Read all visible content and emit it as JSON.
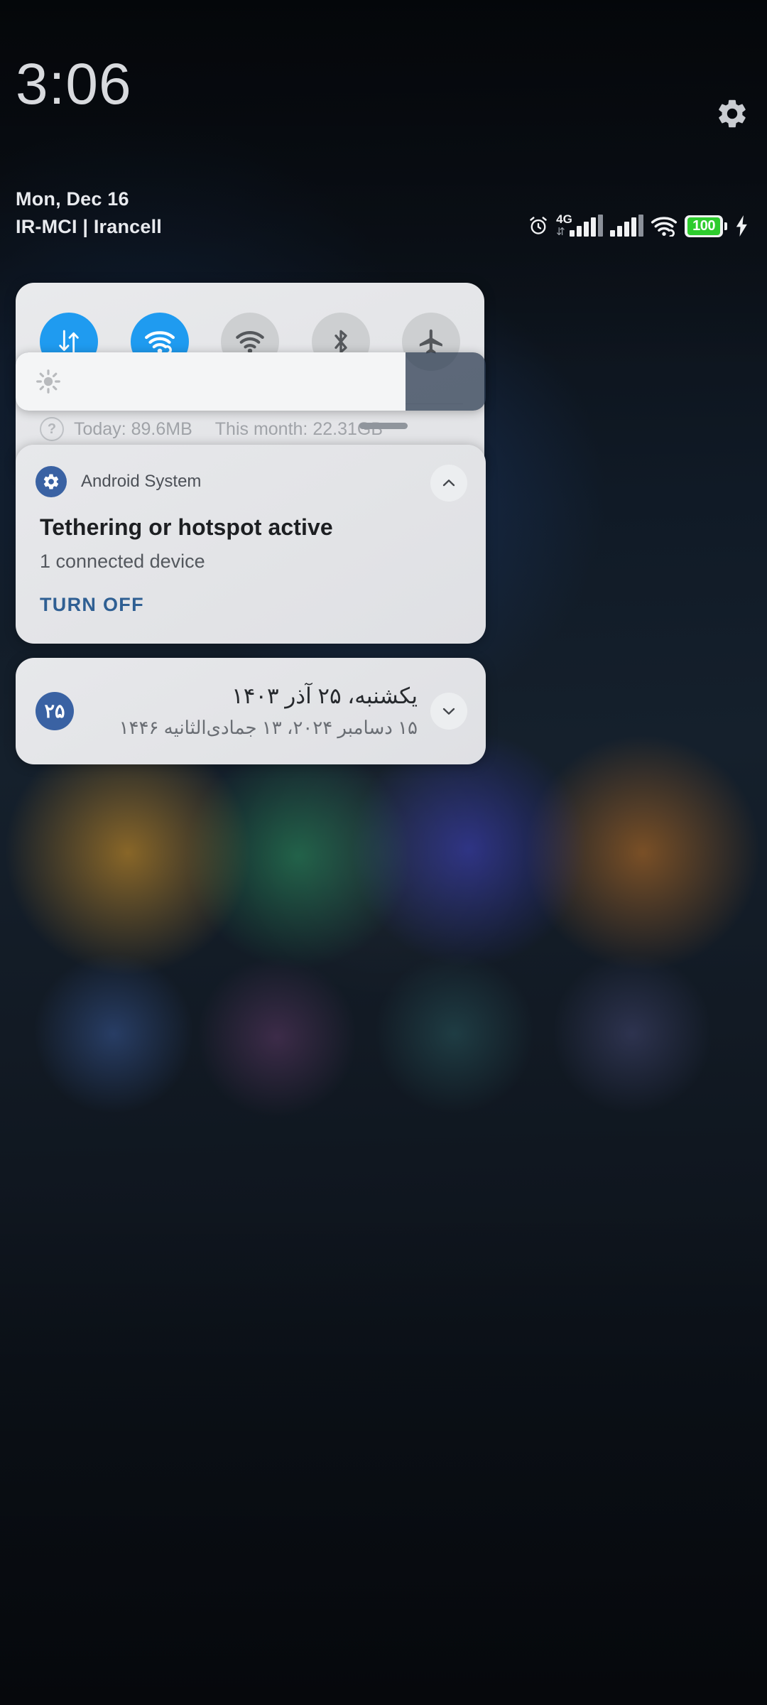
{
  "status_bar": {
    "clock": "3:06",
    "date": "Mon, Dec 16",
    "carrier": "IR-MCI | Irancell",
    "network_type": "4G",
    "battery_level": "100",
    "icons": [
      "alarm-icon",
      "mobile-data-icon",
      "signal-sim1-icon",
      "signal-sim2-icon",
      "wifi-hotspot-icon",
      "battery-icon",
      "charging-bolt-icon"
    ],
    "accent_blue": "#1f9bf0",
    "battery_green": "#2ecc2e"
  },
  "quick_settings": {
    "tiles": [
      {
        "name": "mobile-data",
        "icon": "data-arrows-icon",
        "state": "on"
      },
      {
        "name": "hotspot",
        "icon": "hotspot-icon",
        "state": "on"
      },
      {
        "name": "wifi",
        "icon": "wifi-icon",
        "state": "off"
      },
      {
        "name": "bluetooth",
        "icon": "bluetooth-icon",
        "state": "off"
      },
      {
        "name": "airplane-mode",
        "icon": "airplane-icon",
        "state": "off"
      }
    ],
    "usage_today": "Today: 89.6MB",
    "usage_month": "This month: 22.31GB",
    "help_glyph": "?"
  },
  "brightness": {
    "icon": "brightness-sun-icon",
    "level_percent": 83
  },
  "notifications": [
    {
      "id": "tethering",
      "app_name": "Android System",
      "app_icon": "gear-icon",
      "title": "Tethering or hotspot active",
      "subtitle": "1 connected device",
      "action_label": "TURN OFF",
      "action_color": "#2f5f93",
      "expand_icon": "chevron-up-icon"
    },
    {
      "id": "calendar",
      "badge": "۲۵",
      "primary": "یکشنبه، ۲۵ آذر ۱۴۰۳",
      "secondary": "۱۵ دسامبر ۲۰۲۴، ۱۳ جمادی‌الثانیه ۱۴۴۶",
      "expand_icon": "chevron-down-icon"
    }
  ]
}
